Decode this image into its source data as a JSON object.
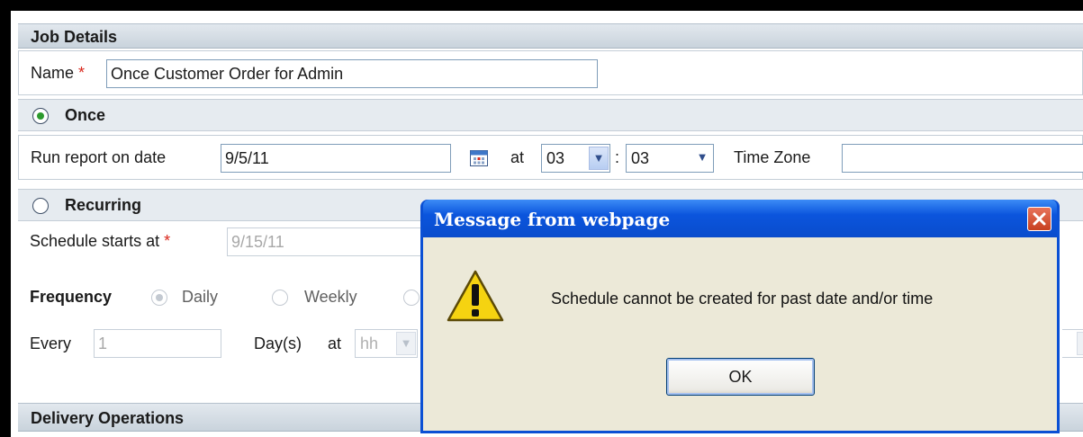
{
  "job_details": {
    "header": "Job Details",
    "name_label": "Name",
    "required_mark": "*",
    "name_value": "Once Customer Order for Admin"
  },
  "once": {
    "label": "Once",
    "selected": true,
    "run_label": "Run report on date",
    "date_value": "9/5/11",
    "at_label": "at",
    "hour": "03",
    "minute": "03",
    "colon": ":",
    "timezone_label": "Time Zone",
    "timezone_value": ""
  },
  "recurring": {
    "label": "Recurring",
    "selected": false,
    "starts_label": "Schedule starts at",
    "starts_value": "9/15/11",
    "frequency_label": "Frequency",
    "frequency_options": [
      "Daily",
      "Weekly"
    ],
    "frequency_selected": "Daily",
    "every_label": "Every",
    "every_value": "1",
    "days_label": "Day(s)",
    "at_label": "at",
    "hour_placeholder": "hh"
  },
  "delivery": {
    "header": "Delivery Operations"
  },
  "dialog": {
    "title": "Message from webpage",
    "message": "Schedule cannot be created for past date and/or time",
    "ok_label": "OK",
    "icon": "warning-icon"
  },
  "colors": {
    "dialog_title_bar": "#0b55dd",
    "dialog_body": "#ece9d8",
    "section_header": "#c9d3dc",
    "required": "#d9271c"
  }
}
